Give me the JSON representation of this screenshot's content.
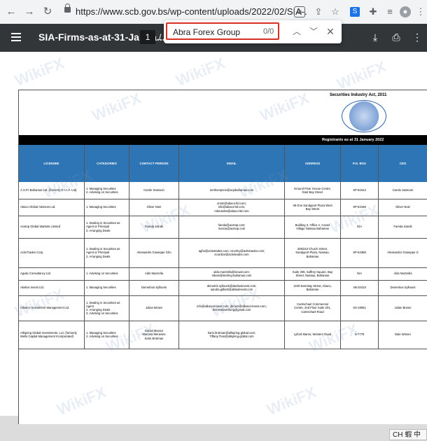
{
  "browser": {
    "url": "https://www.scb.gov.bs/wp-content/uploads/2022/02/SIA-...",
    "nav": {
      "back": "←",
      "forward": "→",
      "reload": "↻"
    }
  },
  "pdf_toolbar": {
    "title": "SIA-Firms-as-at-31-Janua...",
    "current_page": "1",
    "page_sep": "/ 2"
  },
  "find_bar": {
    "query": "Abra Forex Group",
    "count": "0/0"
  },
  "document": {
    "act_title": "Securities Industry Act, 2011",
    "seal_text": "SECURITIES COMMISSION OF THE BAHAMAS",
    "registrants_banner": "Registrants as at 31 January 2022",
    "columns": [
      "LICENSEE",
      "CATEGORIES",
      "CONTACT PERSON",
      "EMAIL",
      "ADDRESS",
      "P.O. BOX",
      "CEO"
    ],
    "rows": [
      {
        "licensee": "A.S.P.I Bahamas Ltd. (formerly R.I.A.F. Ltd)",
        "categories": "1. Managing Securities\n2. Advising on Securities",
        "contact": "Carole Sassoon",
        "email": "methompson@acpibahamas.com",
        "address": "Ground Floor Ocean Centre,\nEast Bay Street",
        "pobox": "SP-61913",
        "ceo": "Carole Sassoon"
      },
      {
        "licensee": "Abaco Global Advisors Ltd.",
        "categories": "1. Managing Securities",
        "contact": "Oliver Notz",
        "email": "onotz@abaco-ltd.com;\ninfo@abaco-ltd.com;\nmknowles@abaco-ltd.com",
        "address": "38 One Sandyport Plaza West\nBay Street",
        "pobox": "SP-64168",
        "ceo": "Oliver Notz"
      },
      {
        "licensee": "Acetop Global Markets Limited",
        "categories": "1. Dealing in Securities as\nAgent or Principal\n2. Arranging Deals",
        "contact": "Fareda Sands",
        "email": "fareda@acetop.com;\nmarcia@acetop.com",
        "address": "Building 3, Office A, Caves\nVillage Nassau Bahamas",
        "pobox": "N/A",
        "ceo": "Fareda Sands"
      },
      {
        "licensee": "ActivTrades Corp.",
        "categories": "1. Dealing in Securities as\nAgent or Principal\n2. Arranging Deals",
        "contact": "Alessandro Giuseppe Gho",
        "email": "agho@activtrades.com; cmorley@activtrades.com;\nscordice@activtrades.com",
        "address": "209/210 Church Street,\nSandyport Plaza, Nassau,\nBahamas",
        "pobox": "SP-64388",
        "ceo": "Alessandro Giuseppe G"
      },
      {
        "licensee": "Aguila Consultancy Ltd.",
        "categories": "1. Advising on Securities",
        "contact": "Aldo Mazzella",
        "email": "aldo.mazzella@nicwal.com;\nmbain@sterling-bahamas.com",
        "address": "Suite 205, Saffrey Square, Bay\nStreet, Nassau, Bahamas",
        "pobox": "N/A",
        "ceo": "Aldo Mazzella"
      },
      {
        "licensee": "Akelius Invest Ltd.",
        "categories": "1. Managing Securities",
        "contact": "Demetrius Syllouris",
        "email": "demetris.syllouris@akeliusinvest.com;\nsandra.gilbert@akliusinvest.com",
        "address": "1100 East Bay Street, Abaco,\nBahamas",
        "pobox": "AB-20415",
        "ceo": "Demetrius Syllouris"
      },
      {
        "licensee": "Alliance Investment Management Ltd.",
        "categories": "1. Dealing in Securities as\nAgent\n2. Arranging Deals\n3. Advising on Securities",
        "contact": "Julian Brown",
        "email": "info@allianceinvest.com; jbrown@allianceinvest.com;\nthenewlowerlong@gmail.com",
        "address": "Carmichael Commercial\nCentre, 2nd Floor Suite 201,\nCarmichael Road",
        "pobox": "SS-19051",
        "ceo": "Julian Brown"
      },
      {
        "licensee": "Allspring Global Investments, LLC (formerly Wells Capital Management Incorporated)",
        "categories": "1. Managing Securities\n2. Advising on Securities",
        "contact": "Daniel Mavico\nMarcela Meneses\nKarin Brotman",
        "email": "karin.brotman@allspring-global.com;\nTiffany.Tran@allspring-global.com",
        "address": "Lyford Manor, Western Road",
        "pobox": "N-7776",
        "ceo": "Dale Winner"
      }
    ]
  },
  "ime": {
    "text": "CH 蝦 中"
  },
  "watermark": {
    "text": "WikiFX"
  }
}
